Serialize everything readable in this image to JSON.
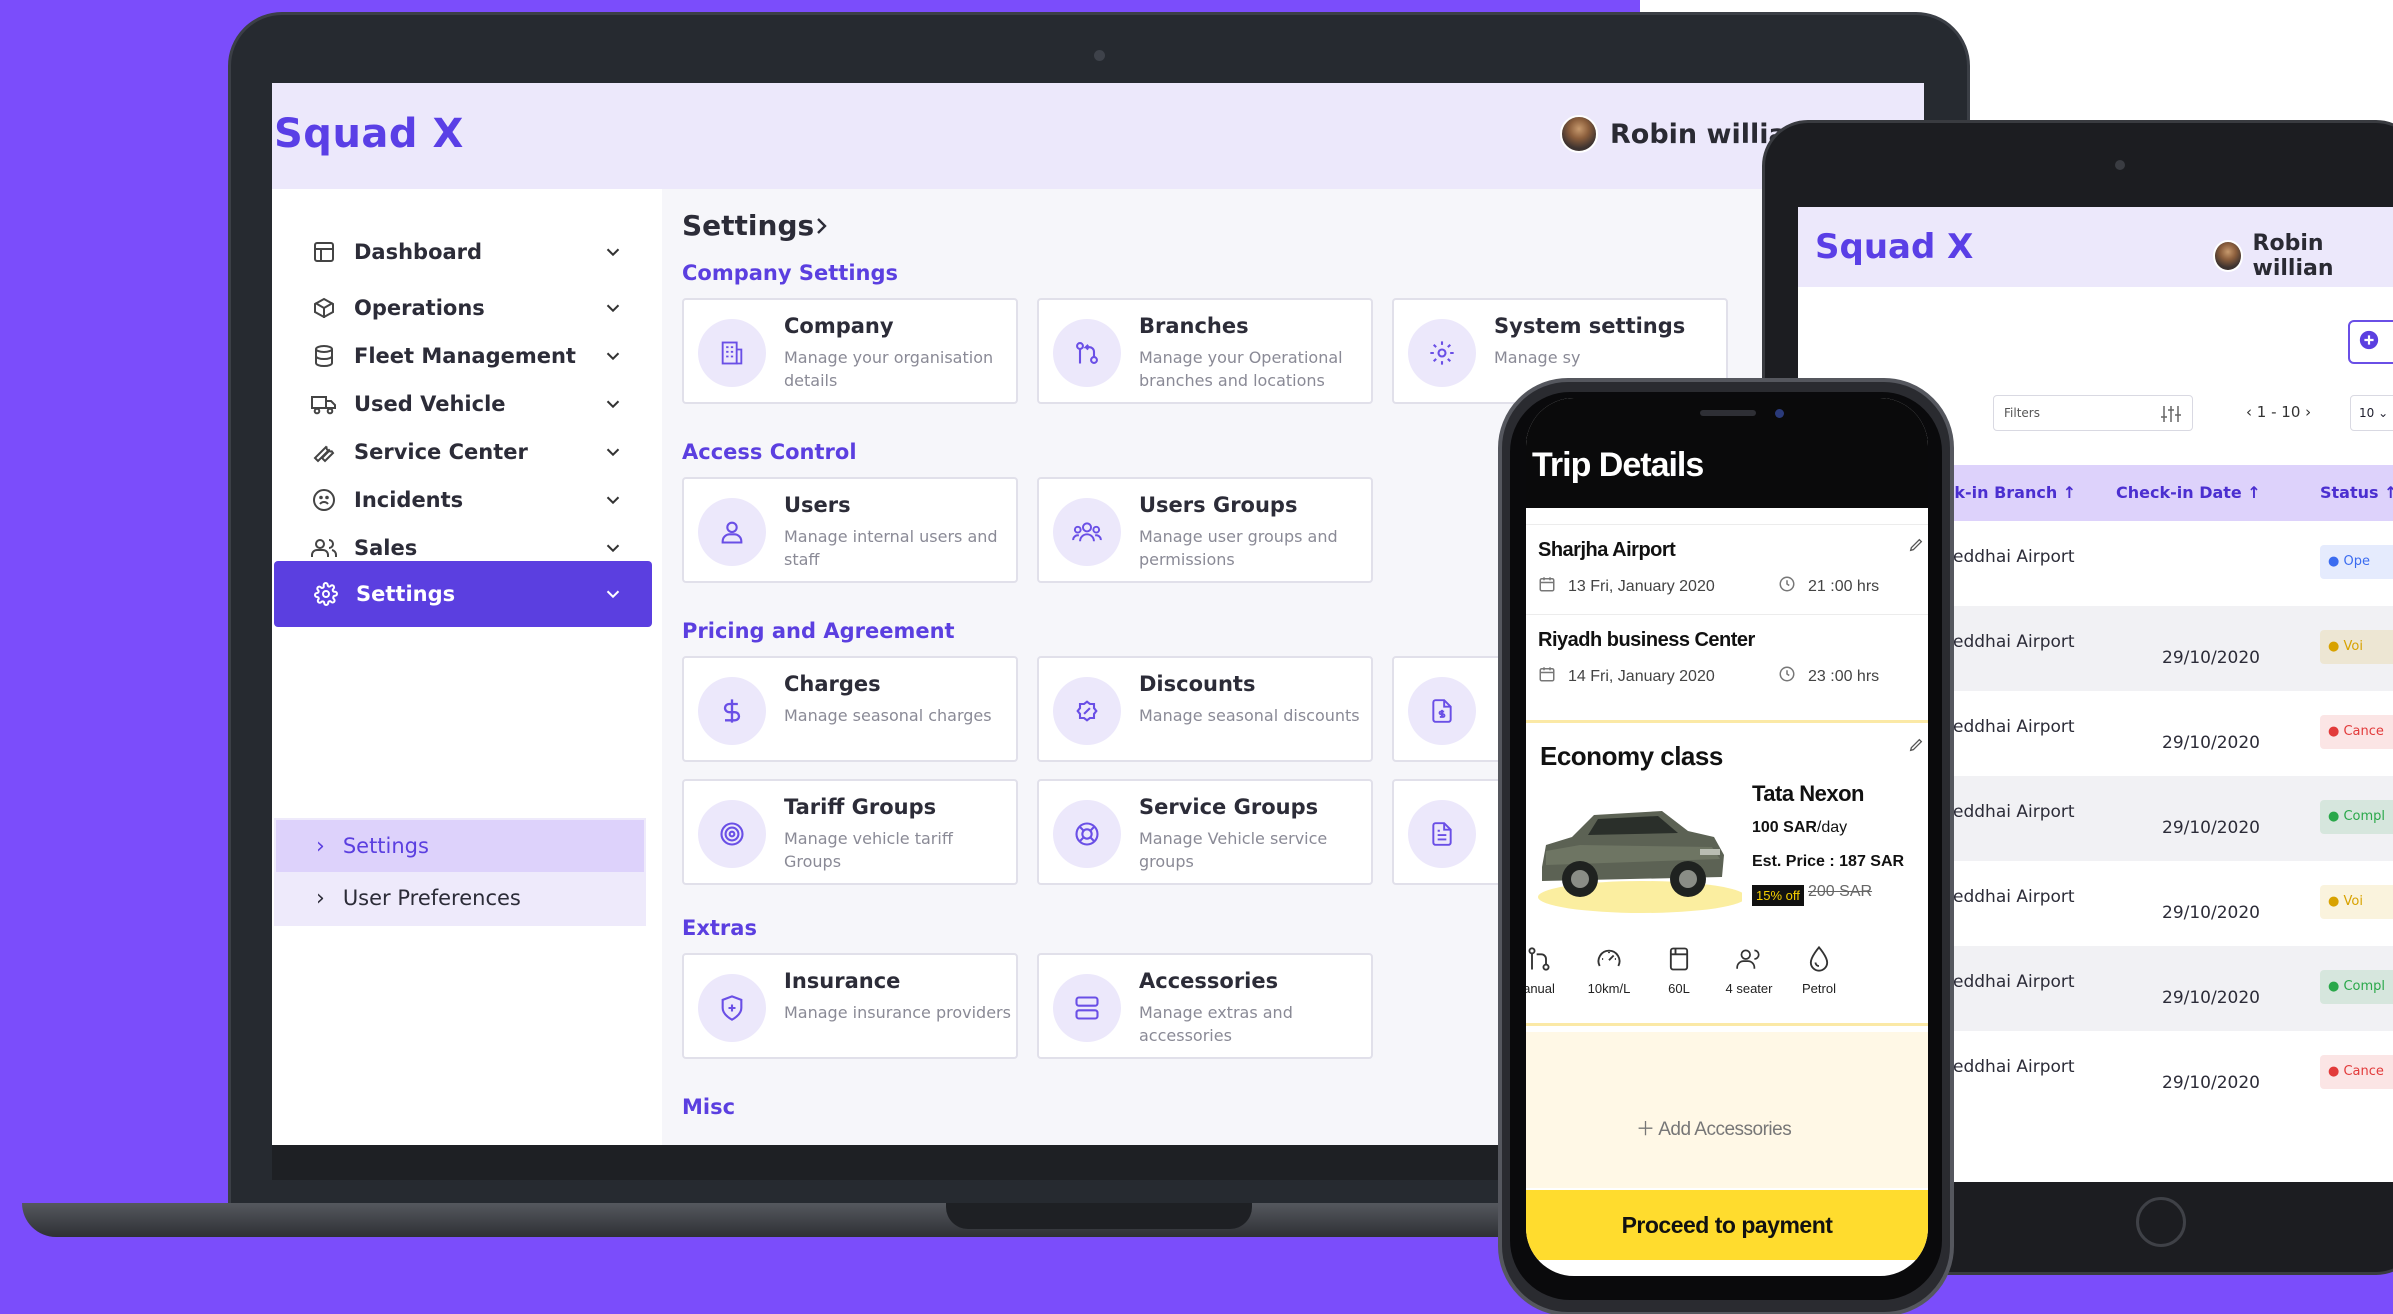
{
  "laptop": {
    "logo": "Squad X",
    "user_name": "Robin willia",
    "sidebar": {
      "items": [
        {
          "label": "Dashboard",
          "icon": "layout-icon"
        },
        {
          "label": "Operations",
          "icon": "box-icon"
        },
        {
          "label": "Fleet Management",
          "icon": "database-icon"
        },
        {
          "label": "Used Vehicle",
          "icon": "truck-icon"
        },
        {
          "label": "Service Center",
          "icon": "wrench-icon"
        },
        {
          "label": "Incidents",
          "icon": "frown-icon"
        },
        {
          "label": "Sales",
          "icon": "users-icon"
        },
        {
          "label": "Settings",
          "icon": "gear-icon",
          "active": true
        }
      ],
      "subitems": [
        {
          "label": "Settings",
          "active": true
        },
        {
          "label": "User Preferences"
        }
      ]
    },
    "breadcrumb": "Settings",
    "sections": {
      "company": "Company Settings",
      "access": "Access Control",
      "pricing": "Pricing and Agreement",
      "extras": "Extras",
      "misc": "Misc"
    },
    "cards": {
      "company": {
        "title": "Company",
        "desc": "Manage your organisation details"
      },
      "branches": {
        "title": "Branches",
        "desc": "Manage your Operational branches and locations"
      },
      "system": {
        "title": "System settings",
        "desc": "Manage sy"
      },
      "users": {
        "title": "Users",
        "desc": "Manage internal users and staff"
      },
      "users_groups": {
        "title": "Users Groups",
        "desc": "Manage user groups and permissions"
      },
      "charges": {
        "title": "Charges",
        "desc": "Manage seasonal charges"
      },
      "discounts": {
        "title": "Discounts",
        "desc": "Manage seasonal discounts"
      },
      "tariff": {
        "title": "Tariff Groups",
        "desc": "Manage vehicle tariff Groups"
      },
      "service_groups": {
        "title": "Service Groups",
        "desc": "Manage Vehicle service groups"
      },
      "insurance": {
        "title": "Insurance",
        "desc": "Manage insurance providers"
      },
      "accessories": {
        "title": "Accessories",
        "desc": "Manage extras and accessories"
      }
    }
  },
  "tablet": {
    "logo": "Squad X",
    "user_name": "Robin willian",
    "filter_placeholder": "Filters",
    "pager": "1 - 10",
    "per_page": "10",
    "columns": [
      "eck-in Branch",
      "Check-in Date",
      "Status"
    ],
    "rows": [
      {
        "branch": "eddhai Airport",
        "date": "",
        "status": "Ope",
        "status_color": "#3b6cf0"
      },
      {
        "branch": "eddhai Airport",
        "date": "29/10/2020",
        "status": "Voi",
        "status_color": "#d8a200"
      },
      {
        "branch": "eddhai Airport",
        "date": "29/10/2020",
        "status": "Cance",
        "status_color": "#e23a3a"
      },
      {
        "branch": "eddhai Airport",
        "date": "29/10/2020",
        "status": "Compl",
        "status_color": "#2aa84a"
      },
      {
        "branch": "eddhai Airport",
        "date": "29/10/2020",
        "status": "Voi",
        "status_color": "#d8a200"
      },
      {
        "branch": "eddhai Airport",
        "date": "29/10/2020",
        "status": "Compl",
        "status_color": "#2aa84a"
      },
      {
        "branch": "eddhai Airport",
        "date": "29/10/2020",
        "status": "Cance",
        "status_color": "#e23a3a"
      }
    ]
  },
  "phone": {
    "title": "Trip Details",
    "pickup": {
      "name": "Sharjha Airport",
      "date": "13 Fri, January 2020",
      "time": "21 :00 hrs"
    },
    "dropoff": {
      "name": "Riyadh business Center",
      "date": "14 Fri, January 2020",
      "time": "23 :00 hrs"
    },
    "class": "Economy class",
    "car": {
      "name": "Tata Nexon",
      "rate": "100 SAR",
      "rate_unit": "/day",
      "est_price": "Est. Price : 187 SAR",
      "discount": "15% off",
      "old_price": "200 SAR"
    },
    "specs": [
      "anual",
      "10km/L",
      "60L",
      "4 seater",
      "Petrol"
    ],
    "add_accessories": "Add Accessories",
    "proceed": "Proceed to payment"
  },
  "colors": {
    "accent": "#5b3fe0",
    "background": "#7b4dfb",
    "cta": "#ffdc2e"
  }
}
